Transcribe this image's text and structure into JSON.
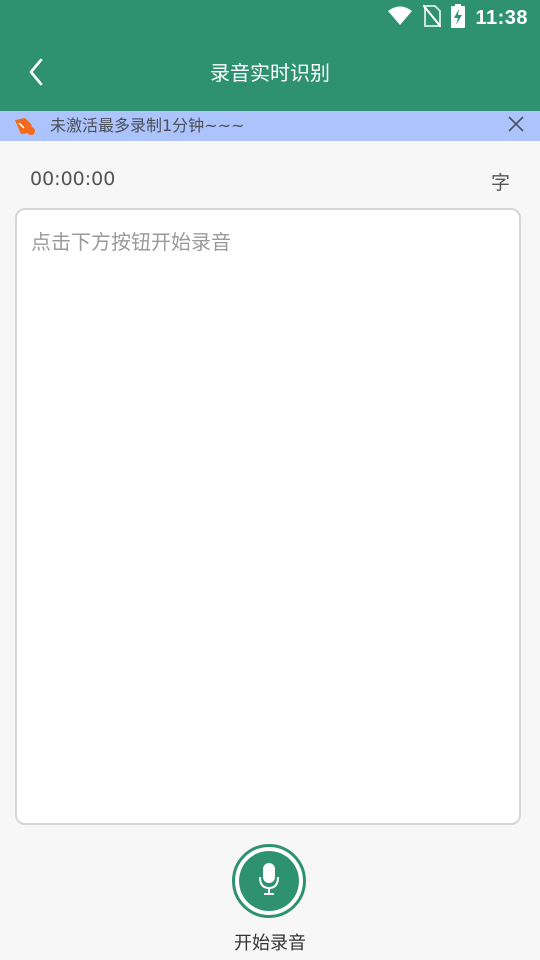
{
  "status_bar": {
    "time": "11:38",
    "icons": [
      "wifi-icon",
      "no-sim-icon",
      "battery-charging-icon"
    ]
  },
  "app_bar": {
    "title": "录音实时识别",
    "back_icon": "chevron-left-icon"
  },
  "banner": {
    "icon": "megaphone-icon",
    "text": "未激活最多录制1分钟~~~",
    "close_icon": "close-icon"
  },
  "info": {
    "timer": "00:00:00",
    "word_count_label": "字"
  },
  "text_area": {
    "placeholder": "点击下方按钮开始录音"
  },
  "record": {
    "icon": "microphone-icon",
    "label": "开始录音"
  },
  "colors": {
    "primary": "#2e9271",
    "banner_bg": "#adc3fb",
    "banner_icon": "#f36a1c",
    "background": "#f7f7f7"
  }
}
